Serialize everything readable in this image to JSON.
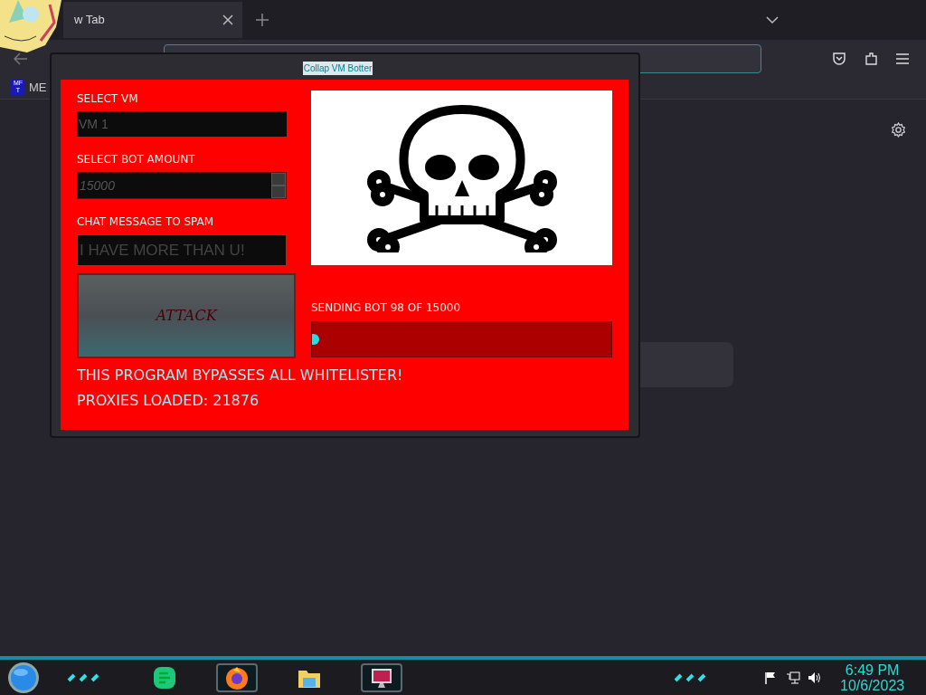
{
  "browser": {
    "tab": {
      "title": "w Tab"
    },
    "bookmarks": [
      {
        "badge_lines": [
          "MF",
          "T"
        ],
        "label": "ME"
      }
    ]
  },
  "app": {
    "title": "Collap VM Botter",
    "fields": [
      {
        "label": "SELECT VM",
        "value": "VM 1",
        "kind": "text"
      },
      {
        "label": "SELECT BOT AMOUNT",
        "value": "15000",
        "kind": "spinner"
      },
      {
        "label": "CHAT MESSAGE TO SPAM",
        "value": "I HAVE MORE THAN U!",
        "kind": "message"
      }
    ],
    "button": "ATTACK",
    "progress": {
      "label": "SENDING BOT 98 OF 15000",
      "level": 0.01
    },
    "notes": [
      "THIS PROGRAM BYPASSES ALL WHITELISTER!",
      "PROXIES LOADED: 21876"
    ]
  },
  "taskbar": {
    "apps": [
      {
        "kind": "notes",
        "selected": false
      },
      {
        "kind": "browser",
        "selected": true
      },
      {
        "kind": "folder",
        "selected": false
      },
      {
        "kind": "monitor",
        "selected": true
      }
    ],
    "clock": {
      "time": "6:49 PM",
      "date": "10/6/2023"
    }
  }
}
